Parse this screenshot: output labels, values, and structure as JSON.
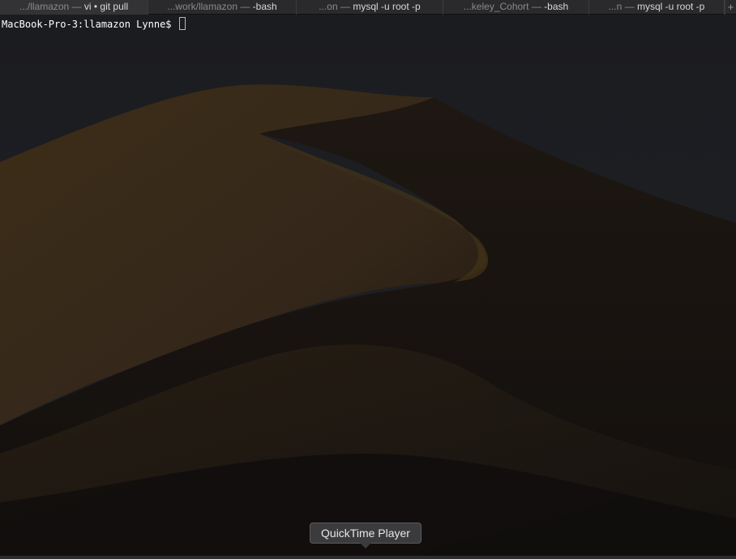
{
  "tabs": [
    {
      "prefix": ".../llamazon — ",
      "main": "vi • git pull"
    },
    {
      "prefix": "...work/llamazon — ",
      "main": "-bash"
    },
    {
      "prefix": "...on — ",
      "main": "mysql -u root -p"
    },
    {
      "prefix": "...keley_Cohort — ",
      "main": "-bash"
    },
    {
      "prefix": "...n — ",
      "main": "mysql -u root -p"
    }
  ],
  "tab_add_label": "+",
  "terminal": {
    "prompt": "MacBook-Pro-3:llamazon Lynne$ "
  },
  "dock": {
    "tooltip": "QuickTime Player"
  },
  "colors": {
    "tabbar_bg": "#2a2a2c",
    "terminal_text": "#ffffff",
    "sand": "#3b2c17",
    "sky": "#1c1d21"
  },
  "icons": [
    "plus-icon",
    "cursor-block"
  ]
}
